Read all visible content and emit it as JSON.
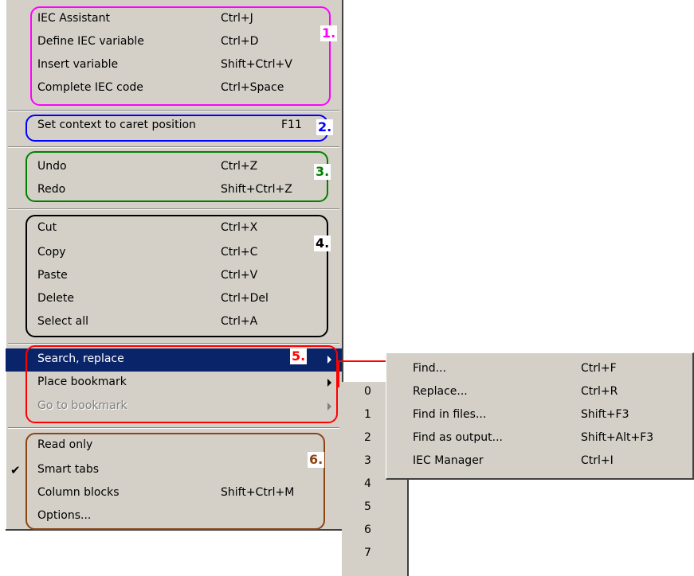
{
  "groups": [
    {
      "number": "1.",
      "color": "#ff00ff",
      "items": [
        {
          "label": "IEC Assistant",
          "shortcut": "Ctrl+J"
        },
        {
          "label": "Define IEC variable",
          "shortcut": "Ctrl+D"
        },
        {
          "label": "Insert variable",
          "shortcut": "Shift+Ctrl+V"
        },
        {
          "label": "Complete IEC code",
          "shortcut": "Ctrl+Space"
        }
      ]
    },
    {
      "number": "2.",
      "color": "#0000ff",
      "items": [
        {
          "label": "Set context to caret position",
          "shortcut": "F11"
        }
      ]
    },
    {
      "number": "3.",
      "color": "#008000",
      "items": [
        {
          "label": "Undo",
          "shortcut": "Ctrl+Z"
        },
        {
          "label": "Redo",
          "shortcut": "Shift+Ctrl+Z"
        }
      ]
    },
    {
      "number": "4.",
      "color": "#000000",
      "items": [
        {
          "label": "Cut",
          "shortcut": "Ctrl+X"
        },
        {
          "label": "Copy",
          "shortcut": "Ctrl+C"
        },
        {
          "label": "Paste",
          "shortcut": "Ctrl+V"
        },
        {
          "label": "Delete",
          "shortcut": "Ctrl+Del"
        },
        {
          "label": "Select all",
          "shortcut": "Ctrl+A"
        }
      ]
    },
    {
      "number": "5.",
      "color": "#ff0000",
      "items": [
        {
          "label": "Search, replace",
          "state": "highlighted",
          "has_submenu": true
        },
        {
          "label": "Place bookmark",
          "has_submenu": true
        },
        {
          "label": "Go to bookmark",
          "state": "disabled",
          "has_submenu": true
        }
      ]
    },
    {
      "number": "6.",
      "color": "#8b4513",
      "items": [
        {
          "label": "Read only"
        },
        {
          "label": "Smart tabs",
          "checked": true
        },
        {
          "label": "Column blocks",
          "shortcut": "Shift+Ctrl+M"
        },
        {
          "label": "Options..."
        }
      ]
    }
  ],
  "search_submenu": [
    {
      "label": "Find...",
      "shortcut": "Ctrl+F"
    },
    {
      "label": "Replace...",
      "shortcut": "Ctrl+R"
    },
    {
      "label": "Find in files...",
      "shortcut": "Shift+F3"
    },
    {
      "label": "Find as output...",
      "shortcut": "Shift+Alt+F3"
    },
    {
      "label": "IEC Manager",
      "shortcut": "Ctrl+I"
    }
  ],
  "bookmark_submenu": [
    "0",
    "1",
    "2",
    "3",
    "4",
    "5",
    "6",
    "7"
  ],
  "check_glyph": "✔"
}
